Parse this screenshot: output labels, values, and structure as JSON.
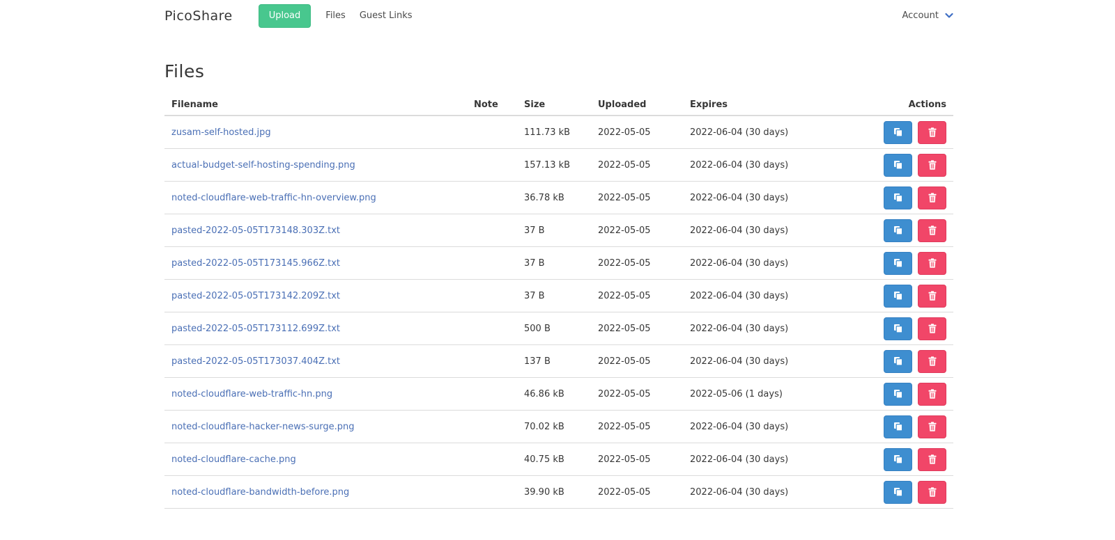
{
  "nav": {
    "brand": "PicoShare",
    "upload_label": "Upload",
    "files_label": "Files",
    "guest_links_label": "Guest Links",
    "account_label": "Account"
  },
  "page": {
    "title": "Files"
  },
  "table": {
    "headers": {
      "filename": "Filename",
      "note": "Note",
      "size": "Size",
      "uploaded": "Uploaded",
      "expires": "Expires",
      "actions": "Actions"
    },
    "rows": [
      {
        "filename": "zusam-self-hosted.jpg",
        "note": "",
        "size": "111.73 kB",
        "uploaded": "2022-05-05",
        "expires": "2022-06-04 (30 days)"
      },
      {
        "filename": "actual-budget-self-hosting-spending.png",
        "note": "",
        "size": "157.13 kB",
        "uploaded": "2022-05-05",
        "expires": "2022-06-04 (30 days)"
      },
      {
        "filename": "noted-cloudflare-web-traffic-hn-overview.png",
        "note": "",
        "size": "36.78 kB",
        "uploaded": "2022-05-05",
        "expires": "2022-06-04 (30 days)"
      },
      {
        "filename": "pasted-2022-05-05T173148.303Z.txt",
        "note": "",
        "size": "37 B",
        "uploaded": "2022-05-05",
        "expires": "2022-06-04 (30 days)"
      },
      {
        "filename": "pasted-2022-05-05T173145.966Z.txt",
        "note": "",
        "size": "37 B",
        "uploaded": "2022-05-05",
        "expires": "2022-06-04 (30 days)"
      },
      {
        "filename": "pasted-2022-05-05T173142.209Z.txt",
        "note": "",
        "size": "37 B",
        "uploaded": "2022-05-05",
        "expires": "2022-06-04 (30 days)"
      },
      {
        "filename": "pasted-2022-05-05T173112.699Z.txt",
        "note": "",
        "size": "500 B",
        "uploaded": "2022-05-05",
        "expires": "2022-06-04 (30 days)"
      },
      {
        "filename": "pasted-2022-05-05T173037.404Z.txt",
        "note": "",
        "size": "137 B",
        "uploaded": "2022-05-05",
        "expires": "2022-06-04 (30 days)"
      },
      {
        "filename": "noted-cloudflare-web-traffic-hn.png",
        "note": "",
        "size": "46.86 kB",
        "uploaded": "2022-05-05",
        "expires": "2022-05-06 (1 days)"
      },
      {
        "filename": "noted-cloudflare-hacker-news-surge.png",
        "note": "",
        "size": "70.02 kB",
        "uploaded": "2022-05-05",
        "expires": "2022-06-04 (30 days)"
      },
      {
        "filename": "noted-cloudflare-cache.png",
        "note": "",
        "size": "40.75 kB",
        "uploaded": "2022-05-05",
        "expires": "2022-06-04 (30 days)"
      },
      {
        "filename": "noted-cloudflare-bandwidth-before.png",
        "note": "",
        "size": "39.90 kB",
        "uploaded": "2022-05-05",
        "expires": "2022-06-04 (30 days)"
      }
    ]
  },
  "icons": {
    "copy": "copy-icon",
    "delete": "trash-icon",
    "account_chevron": "chevron-down-icon"
  },
  "colors": {
    "upload_button": "#48c78e",
    "copy_button": "#3e8ed0",
    "delete_button": "#f14668",
    "link": "#4a6fb5"
  }
}
